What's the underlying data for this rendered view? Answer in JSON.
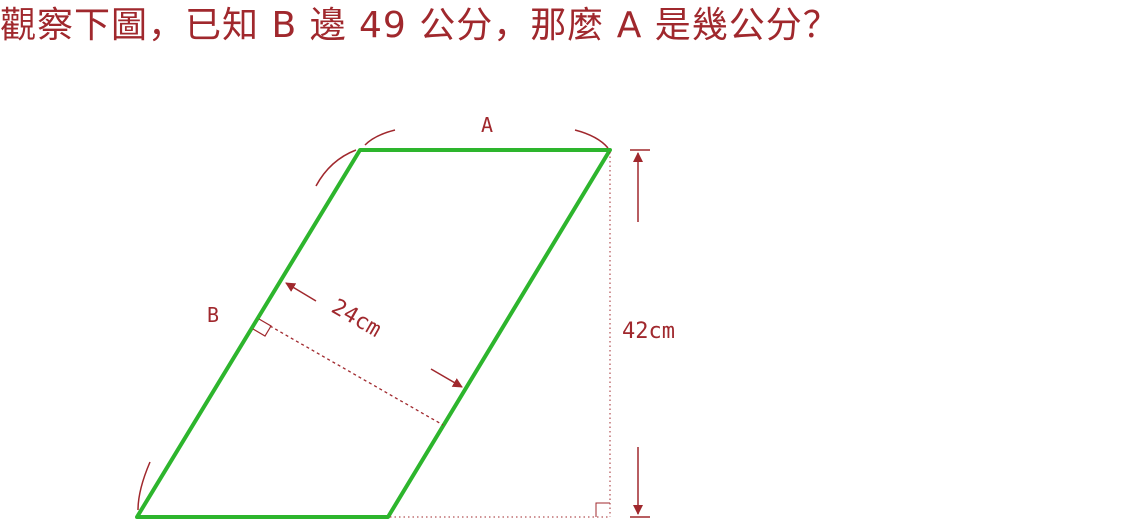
{
  "question": "觀察下圖，已知 B 邊 49 公分，那麼 A 是幾公分？",
  "labels": {
    "side_a": "A",
    "side_b": "B",
    "perpendicular": "24cm",
    "height": "42cm"
  },
  "colors": {
    "text": "#a0282d",
    "parallelogram": "#2db52d",
    "guide": "#a0282d"
  }
}
